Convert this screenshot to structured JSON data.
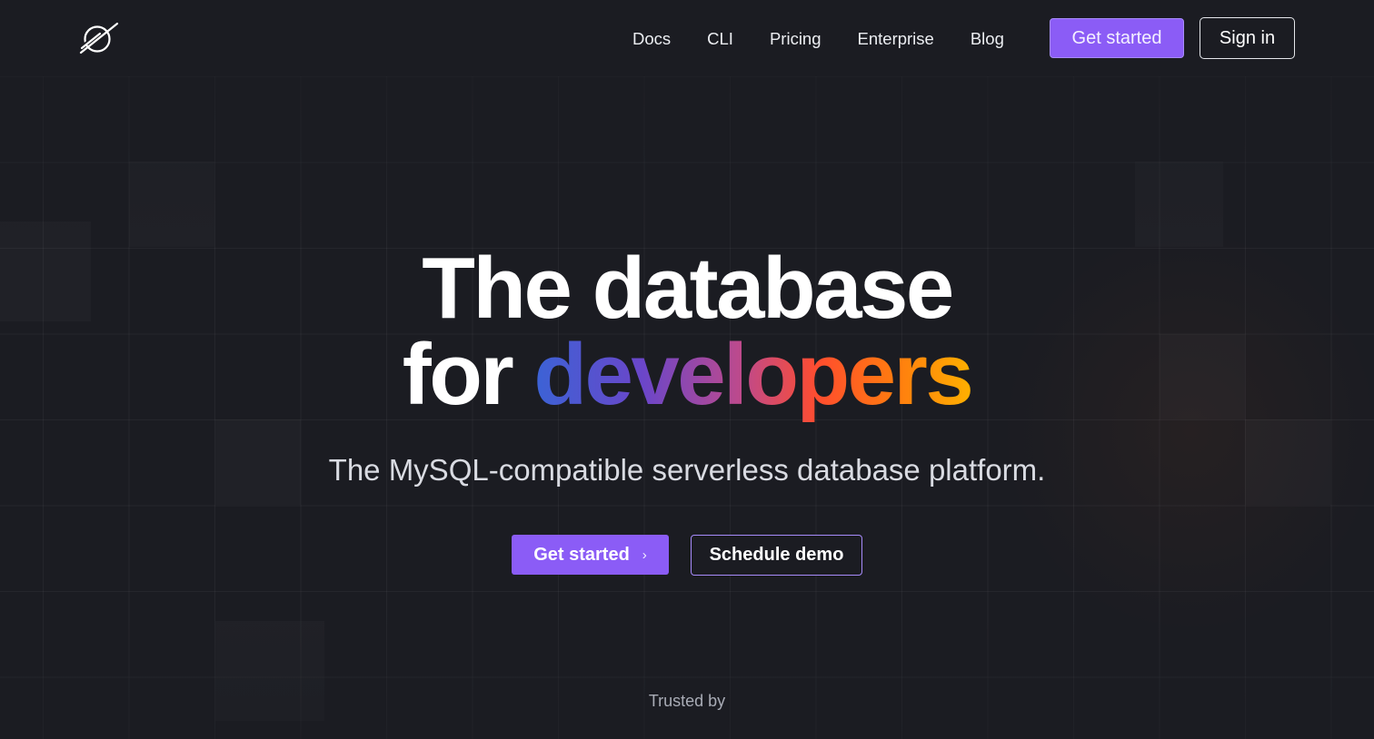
{
  "nav": {
    "logo_icon": "planetscale-logo-icon",
    "links": [
      {
        "label": "Docs"
      },
      {
        "label": "CLI"
      },
      {
        "label": "Pricing"
      },
      {
        "label": "Enterprise"
      },
      {
        "label": "Blog"
      }
    ],
    "get_started_label": "Get started",
    "sign_in_label": "Sign in"
  },
  "hero": {
    "title_line1": "The database",
    "title_line2_prefix": "for ",
    "title_line2_highlight": "developers",
    "subtitle": "The MySQL-compatible serverless database platform.",
    "cta_primary_label": "Get started",
    "cta_primary_icon": "chevron-right-icon",
    "cta_secondary_label": "Schedule demo"
  },
  "footer": {
    "trusted_label": "Trusted by"
  },
  "colors": {
    "background": "#1b1c22",
    "accent": "#8b5cf6",
    "accent_border": "#a78bfa",
    "text": "#ffffff",
    "muted_text": "#a9acb6"
  }
}
